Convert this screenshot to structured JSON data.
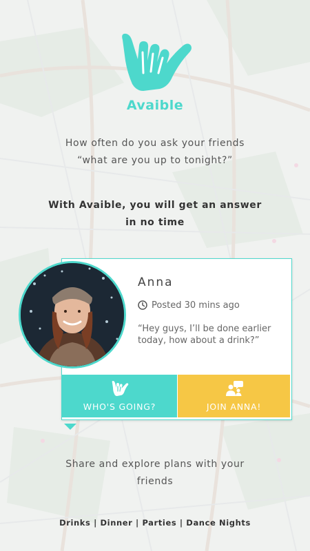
{
  "app": {
    "name": "Avaible"
  },
  "intro": {
    "line1": "How often do you ask your friends",
    "line2": "“what are you up to tonight?”"
  },
  "pitch": {
    "line1": "With Avaible, you will get an answer",
    "line2": "in no time"
  },
  "post": {
    "author": "Anna",
    "posted": "Posted 30 mins ago",
    "message_line1": "“Hey guys, I’ll be done earlier",
    "message_line2": "today, how about a drink?”",
    "avatar_icon": "profile-photo"
  },
  "actions": {
    "going_label": "WHO'S GOING?",
    "going_icon": "shaka-hand-icon",
    "join_label": "JOIN ANNA!",
    "join_icon": "people-chat-icon"
  },
  "share": {
    "line1": "Share and explore plans with your",
    "line2": "friends"
  },
  "footer": {
    "categories": "Drinks | Dinner | Parties | Dance Nights"
  },
  "colors": {
    "accent": "#4dd8cc",
    "join": "#f6c745"
  }
}
